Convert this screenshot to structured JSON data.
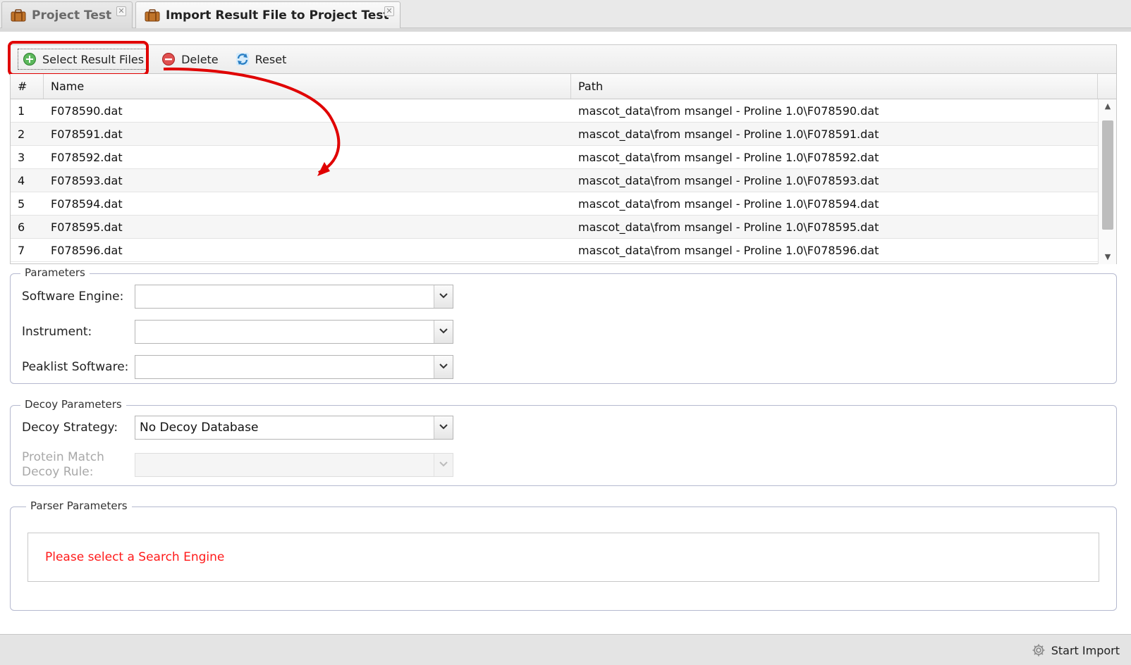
{
  "tabs": [
    {
      "label": "Project Test",
      "close": "✕"
    },
    {
      "label": "Import Result File to Project Test",
      "close": "✕"
    }
  ],
  "toolbar": {
    "select_label": "Select Result Files",
    "delete_label": "Delete",
    "reset_label": "Reset"
  },
  "grid": {
    "columns": [
      "#",
      "Name",
      "Path"
    ],
    "rows": [
      {
        "num": "1",
        "name": "F078590.dat",
        "path": "mascot_data\\from msangel - Proline 1.0\\F078590.dat"
      },
      {
        "num": "2",
        "name": "F078591.dat",
        "path": "mascot_data\\from msangel - Proline 1.0\\F078591.dat"
      },
      {
        "num": "3",
        "name": "F078592.dat",
        "path": "mascot_data\\from msangel - Proline 1.0\\F078592.dat"
      },
      {
        "num": "4",
        "name": "F078593.dat",
        "path": "mascot_data\\from msangel - Proline 1.0\\F078593.dat"
      },
      {
        "num": "5",
        "name": "F078594.dat",
        "path": "mascot_data\\from msangel - Proline 1.0\\F078594.dat"
      },
      {
        "num": "6",
        "name": "F078595.dat",
        "path": "mascot_data\\from msangel - Proline 1.0\\F078595.dat"
      },
      {
        "num": "7",
        "name": "F078596.dat",
        "path": "mascot_data\\from msangel - Proline 1.0\\F078596.dat"
      }
    ]
  },
  "parameters": {
    "legend": "Parameters",
    "software_engine_label": "Software Engine:",
    "software_engine_value": "",
    "instrument_label": "Instrument:",
    "instrument_value": "",
    "peaklist_label": "Peaklist Software:",
    "peaklist_value": ""
  },
  "decoy": {
    "legend": "Decoy Parameters",
    "strategy_label": "Decoy Strategy:",
    "strategy_value": "No Decoy Database",
    "rule_label_line1": "Protein Match",
    "rule_label_line2": "Decoy Rule:",
    "rule_value": ""
  },
  "parser": {
    "legend": "Parser Parameters",
    "message": "Please select a Search Engine"
  },
  "footer": {
    "start_label": "Start Import"
  },
  "colors": {
    "highlight": "#e00000",
    "error_text": "#ff1a1a"
  }
}
